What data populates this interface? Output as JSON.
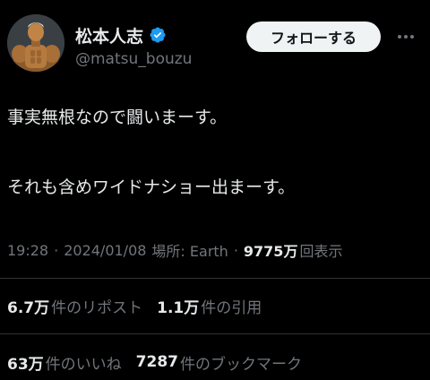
{
  "author": {
    "display_name": "松本人志",
    "handle": "@matsu_bouzu",
    "verified": true,
    "avatar_icon": "profile-photo-figure"
  },
  "follow_button": {
    "label": "フォローする"
  },
  "more_icon": "more-horizontal-icon",
  "tweet": {
    "lines": [
      "事実無根なので闘いまーす。",
      "それも含めワイドナショー出まーす。"
    ]
  },
  "meta": {
    "time": "19:28",
    "separator": "·",
    "date": "2024/01/08",
    "location": "場所: Earth",
    "views_count": "9775万",
    "views_label": "回表示"
  },
  "stats": {
    "reposts": {
      "count": "6.7万",
      "label": "件のリポスト"
    },
    "quotes": {
      "count": "1.1万",
      "label": "件の引用"
    },
    "likes": {
      "count": "63万",
      "label": "件のいいね"
    },
    "bookmarks": {
      "count": "7287",
      "label": "件のブックマーク"
    }
  },
  "colors": {
    "background": "#000000",
    "text_primary": "#e7e9ea",
    "text_secondary": "#71767b",
    "verified_blue": "#1d9bf0",
    "divider": "#2f3336",
    "follow_button_bg": "#eff3f4"
  }
}
